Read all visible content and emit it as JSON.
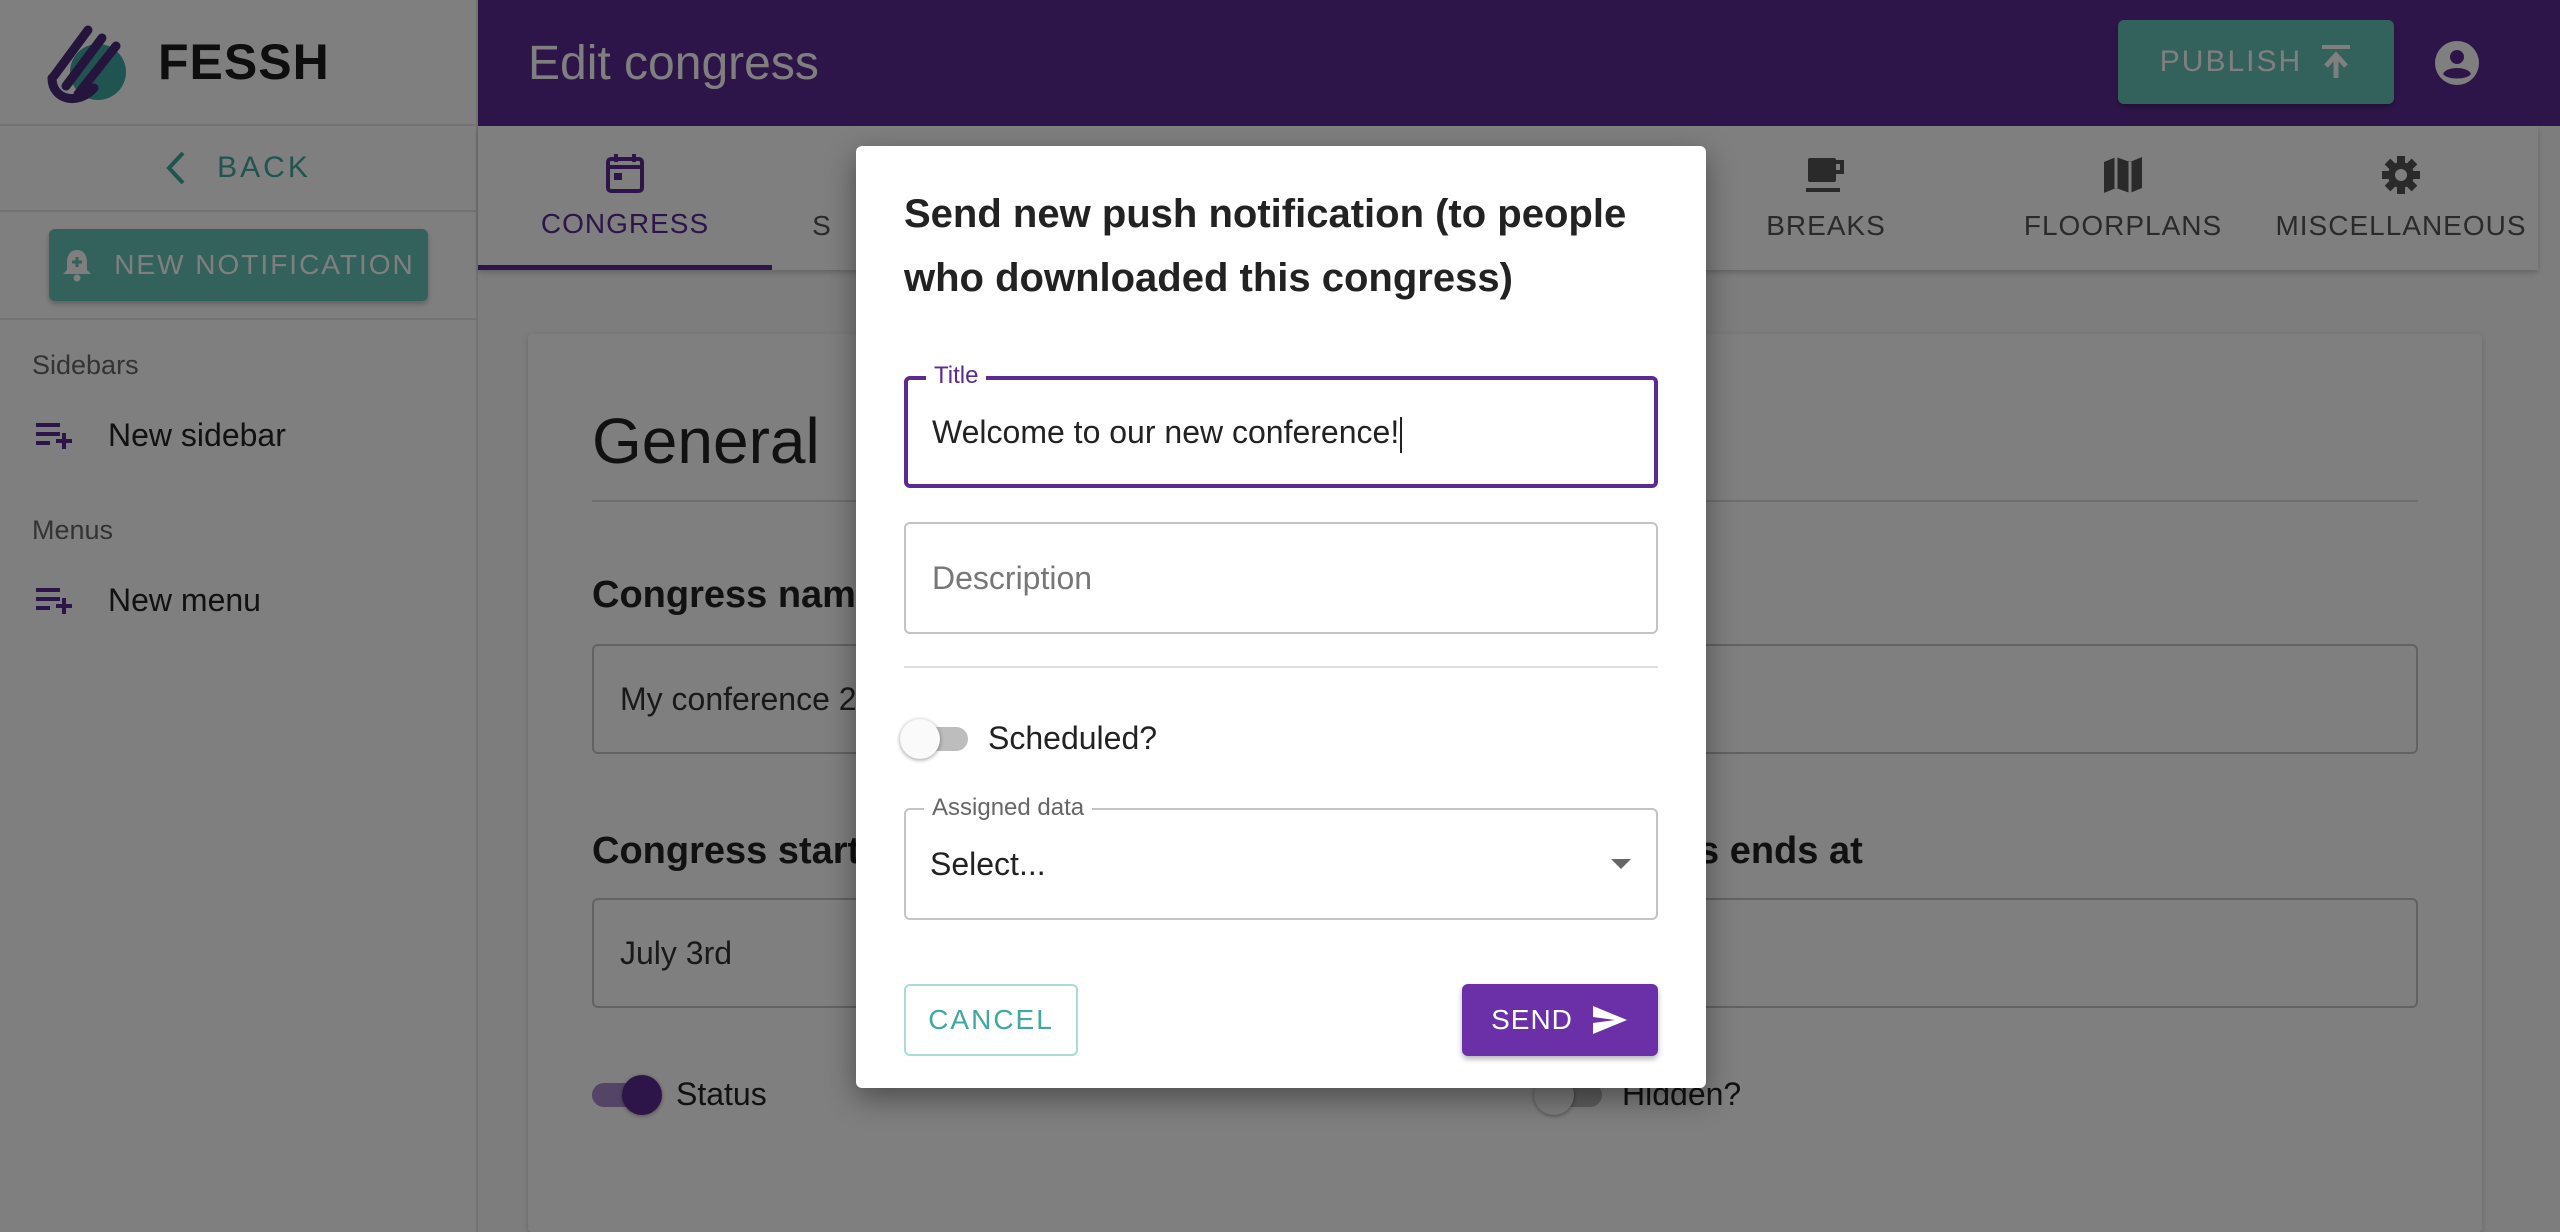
{
  "app": {
    "name": "FESSH"
  },
  "sidebar": {
    "back_label": "BACK",
    "new_notification_label": "NEW NOTIFICATION",
    "sidebars_section": "Sidebars",
    "new_sidebar_label": "New sidebar",
    "menus_section": "Menus",
    "new_menu_label": "New menu"
  },
  "header": {
    "title": "Edit congress",
    "publish_label": "PUBLISH"
  },
  "tabs": [
    {
      "label": "CONGRESS",
      "icon": "calendar-icon",
      "active": true
    },
    {
      "label": "S",
      "icon": "partial-tab-icon"
    },
    {
      "label": "BREAKS",
      "icon": "coffee-icon"
    },
    {
      "label": "FLOORPLANS",
      "icon": "map-icon"
    },
    {
      "label": "MISCELLANEOUS",
      "icon": "gear-icon"
    }
  ],
  "main": {
    "section_title": "General",
    "congress_name_label": "Congress nam",
    "congress_name_value": "My conference 2",
    "start_label": "Congress start",
    "start_value": "July 3rd",
    "end_label": "s ends at",
    "status_label": "Status",
    "status_on": true,
    "hidden_label": "Hidden?",
    "hidden_on": false
  },
  "dialog": {
    "title": "Send new push notification (to people who downloaded this congress)",
    "title_field_label": "Title",
    "title_field_value": "Welcome to our new conference!",
    "description_placeholder": "Description",
    "scheduled_label": "Scheduled?",
    "scheduled_on": false,
    "assigned_label": "Assigned data",
    "assigned_value": "Select...",
    "cancel_label": "CANCEL",
    "send_label": "SEND"
  },
  "colors": {
    "primary": "#5b2b93",
    "accent": "#66c2b8",
    "send": "#6b2fa8"
  }
}
